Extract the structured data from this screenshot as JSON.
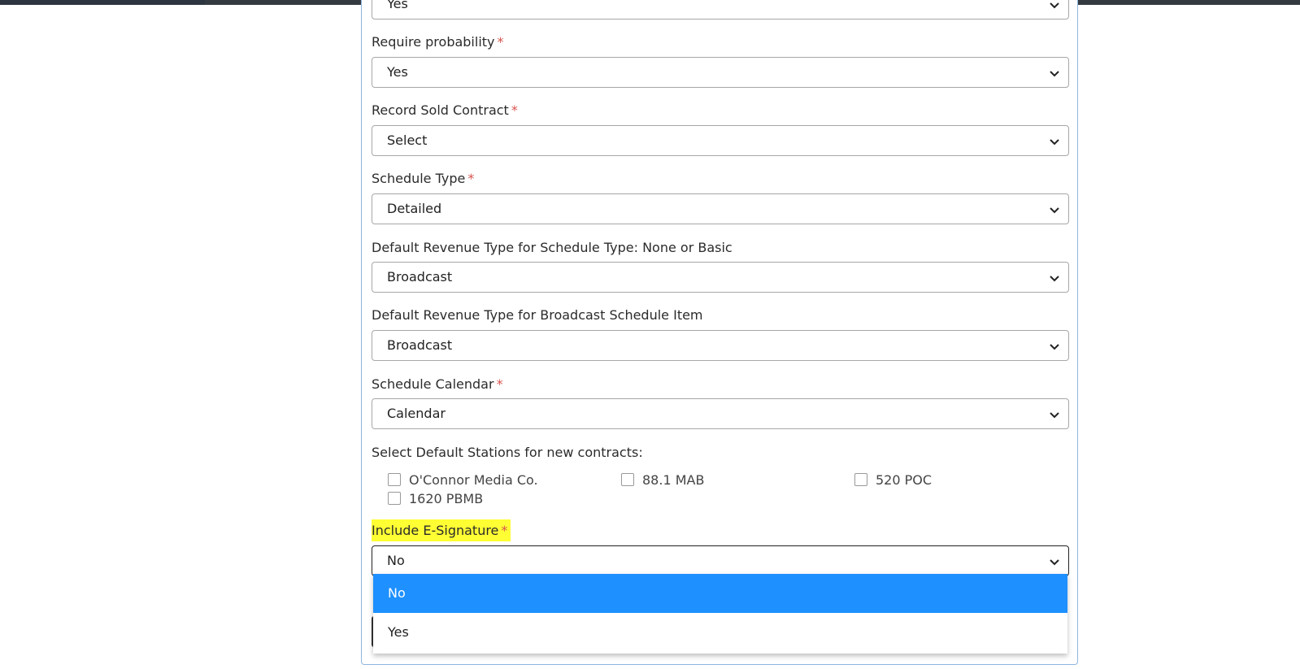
{
  "form": {
    "top_select_value": "Yes",
    "require_probability": {
      "label": "Require probability",
      "value": "Yes",
      "required": "*"
    },
    "record_sold_contract": {
      "label": "Record Sold Contract",
      "value": "Select",
      "required": "*"
    },
    "schedule_type": {
      "label": "Schedule Type",
      "value": "Detailed",
      "required": "*"
    },
    "default_revenue_none_basic": {
      "label": "Default Revenue Type for Schedule Type: None or Basic",
      "value": "Broadcast"
    },
    "default_revenue_broadcast_item": {
      "label": "Default Revenue Type for Broadcast Schedule Item",
      "value": "Broadcast"
    },
    "schedule_calendar": {
      "label": "Schedule Calendar",
      "value": "Calendar",
      "required": "*"
    },
    "default_stations": {
      "label": "Select Default Stations for new contracts:",
      "stations": [
        "O'Connor Media Co.",
        "88.1 MAB",
        "520 POC",
        "1620 PBMB"
      ]
    },
    "include_esignature": {
      "label": "Include E-Signature",
      "required": "*",
      "value": "No",
      "options": [
        "No",
        "Yes"
      ],
      "highlighted_option": "No"
    }
  },
  "colors": {
    "accent": "#1e90ff",
    "required": "#d9534f",
    "highlight": "#ffff33",
    "panel_border": "#8fb6e0"
  }
}
